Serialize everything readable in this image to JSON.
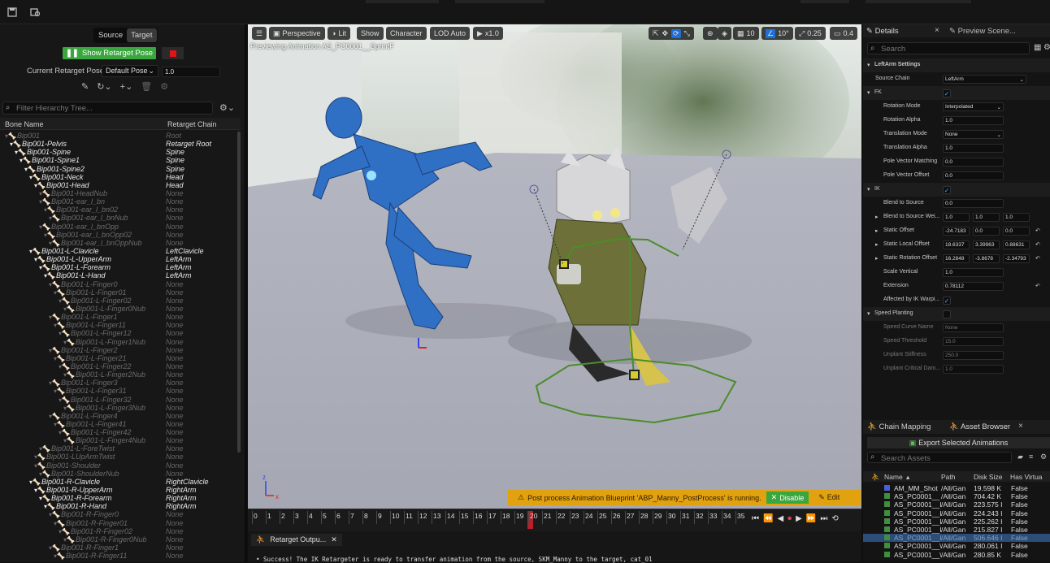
{
  "topbar": {
    "save_icon": "save-icon",
    "browse_icon": "browse-icon"
  },
  "left": {
    "tabs": [
      "Source",
      "Target"
    ],
    "show_retarget_pose": "Show Retarget Pose",
    "current_pose_label": "Current Retarget Pose:",
    "current_pose_value": "Default Pose",
    "pose_blend_value": "1.0",
    "filter_placeholder": "Filter Hierarchy Tree...",
    "col_bone": "Bone Name",
    "col_chain": "Retarget Chain",
    "bones": [
      {
        "name": "Bip001",
        "chain": "Root",
        "d": 0,
        "on": false
      },
      {
        "name": "Bip001-Pelvis",
        "chain": "Retarget Root",
        "d": 1,
        "on": true
      },
      {
        "name": "Bip001-Spine",
        "chain": "Spine",
        "d": 2,
        "on": true
      },
      {
        "name": "Bip001-Spine1",
        "chain": "Spine",
        "d": 3,
        "on": true
      },
      {
        "name": "Bip001-Spine2",
        "chain": "Spine",
        "d": 4,
        "on": true
      },
      {
        "name": "Bip001-Neck",
        "chain": "Head",
        "d": 5,
        "on": true
      },
      {
        "name": "Bip001-Head",
        "chain": "Head",
        "d": 6,
        "on": true
      },
      {
        "name": "Bip001-HeadNub",
        "chain": "None",
        "d": 7,
        "on": false
      },
      {
        "name": "Bip001-ear_l_bn",
        "chain": "None",
        "d": 7,
        "on": false
      },
      {
        "name": "Bip001-ear_l_bn02",
        "chain": "None",
        "d": 8,
        "on": false
      },
      {
        "name": "Bip001-ear_l_bnNub",
        "chain": "None",
        "d": 9,
        "on": false
      },
      {
        "name": "Bip001-ear_l_bnOpp",
        "chain": "None",
        "d": 7,
        "on": false
      },
      {
        "name": "Bip001-ear_l_bnOpp02",
        "chain": "None",
        "d": 8,
        "on": false
      },
      {
        "name": "Bip001-ear_l_bnOppNub",
        "chain": "None",
        "d": 9,
        "on": false
      },
      {
        "name": "Bip001-L-Clavicle",
        "chain": "LeftClavicle",
        "d": 5,
        "on": true
      },
      {
        "name": "Bip001-L-UpperArm",
        "chain": "LeftArm",
        "d": 6,
        "on": true
      },
      {
        "name": "Bip001-L-Forearm",
        "chain": "LeftArm",
        "d": 7,
        "on": true
      },
      {
        "name": "Bip001-L-Hand",
        "chain": "LeftArm",
        "d": 8,
        "on": true
      },
      {
        "name": "Bip001-L-Finger0",
        "chain": "None",
        "d": 9,
        "on": false
      },
      {
        "name": "Bip001-L-Finger01",
        "chain": "None",
        "d": 10,
        "on": false
      },
      {
        "name": "Bip001-L-Finger02",
        "chain": "None",
        "d": 11,
        "on": false
      },
      {
        "name": "Bip001-L-Finger0Nub",
        "chain": "None",
        "d": 12,
        "on": false
      },
      {
        "name": "Bip001-L-Finger1",
        "chain": "None",
        "d": 9,
        "on": false
      },
      {
        "name": "Bip001-L-Finger11",
        "chain": "None",
        "d": 10,
        "on": false
      },
      {
        "name": "Bip001-L-Finger12",
        "chain": "None",
        "d": 11,
        "on": false
      },
      {
        "name": "Bip001-L-Finger1Nub",
        "chain": "None",
        "d": 12,
        "on": false
      },
      {
        "name": "Bip001-L-Finger2",
        "chain": "None",
        "d": 9,
        "on": false
      },
      {
        "name": "Bip001-L-Finger21",
        "chain": "None",
        "d": 10,
        "on": false
      },
      {
        "name": "Bip001-L-Finger22",
        "chain": "None",
        "d": 11,
        "on": false
      },
      {
        "name": "Bip001-L-Finger2Nub",
        "chain": "None",
        "d": 12,
        "on": false
      },
      {
        "name": "Bip001-L-Finger3",
        "chain": "None",
        "d": 9,
        "on": false
      },
      {
        "name": "Bip001-L-Finger31",
        "chain": "None",
        "d": 10,
        "on": false
      },
      {
        "name": "Bip001-L-Finger32",
        "chain": "None",
        "d": 11,
        "on": false
      },
      {
        "name": "Bip001-L-Finger3Nub",
        "chain": "None",
        "d": 12,
        "on": false
      },
      {
        "name": "Bip001-L-Finger4",
        "chain": "None",
        "d": 9,
        "on": false
      },
      {
        "name": "Bip001-L-Finger41",
        "chain": "None",
        "d": 10,
        "on": false
      },
      {
        "name": "Bip001-L-Finger42",
        "chain": "None",
        "d": 11,
        "on": false
      },
      {
        "name": "Bip001-L-Finger4Nub",
        "chain": "None",
        "d": 12,
        "on": false
      },
      {
        "name": "Bip001-L-ForeTwist",
        "chain": "None",
        "d": 7,
        "on": false
      },
      {
        "name": "Bip001-LUpArmTwist",
        "chain": "None",
        "d": 6,
        "on": false
      },
      {
        "name": "Bip001-Shoulder",
        "chain": "None",
        "d": 6,
        "on": false
      },
      {
        "name": "Bip001-ShoulderNub",
        "chain": "None",
        "d": 7,
        "on": false
      },
      {
        "name": "Bip001-R-Clavicle",
        "chain": "RightClavicle",
        "d": 5,
        "on": true
      },
      {
        "name": "Bip001-R-UpperArm",
        "chain": "RightArm",
        "d": 6,
        "on": true
      },
      {
        "name": "Bip001-R-Forearm",
        "chain": "RightArm",
        "d": 7,
        "on": true
      },
      {
        "name": "Bip001-R-Hand",
        "chain": "RightArm",
        "d": 8,
        "on": true
      },
      {
        "name": "Bip001-R-Finger0",
        "chain": "None",
        "d": 9,
        "on": false
      },
      {
        "name": "Bip001-R-Finger01",
        "chain": "None",
        "d": 10,
        "on": false
      },
      {
        "name": "Bip001-R-Finger02",
        "chain": "None",
        "d": 11,
        "on": false
      },
      {
        "name": "Bip001-R-Finger0Nub",
        "chain": "None",
        "d": 12,
        "on": false
      },
      {
        "name": "Bip001-R-Finger1",
        "chain": "None",
        "d": 9,
        "on": false
      },
      {
        "name": "Bip001-R-Finger11",
        "chain": "None",
        "d": 10,
        "on": false
      }
    ]
  },
  "viewport": {
    "perspective": "Perspective",
    "lit": "Lit",
    "show": "Show",
    "character": "Character",
    "lod": "LOD Auto",
    "speed": "x1.0",
    "grid_size": "10",
    "angle": "10°",
    "scale": "0.25",
    "camera_speed": "0.4",
    "preview_text": "Previewing Animation AS_PC0001__SprintF",
    "warning": "Post process Animation Blueprint 'ABP_Manny_PostProcess' is running.",
    "disable": "Disable",
    "edit": "Edit"
  },
  "timeline": {
    "frames": [
      "0",
      "1",
      "2",
      "3",
      "4",
      "5",
      "6",
      "7",
      "8",
      "9",
      "10",
      "11",
      "12",
      "13",
      "14",
      "15",
      "16",
      "17",
      "18",
      "19",
      "20",
      "21",
      "22",
      "23",
      "24",
      "25",
      "26",
      "27",
      "28",
      "29",
      "30",
      "31",
      "32",
      "33",
      "34",
      "35"
    ],
    "current": 20
  },
  "log": {
    "tab": "Retarget Outpu...",
    "message": "Success! The IK Retargeter is ready to transfer animation from the source, SKM_Manny to the target, cat_01"
  },
  "details": {
    "tab": "Details",
    "tab2": "Preview Scene...",
    "search_placeholder": "Search",
    "section": "LeftArm Settings",
    "source_chain_label": "Source Chain",
    "source_chain_value": "LeftArm",
    "fk": "FK",
    "rotation_mode_label": "Rotation Mode",
    "rotation_mode_value": "Interpolated",
    "rotation_alpha_label": "Rotation Alpha",
    "rotation_alpha_value": "1.0",
    "translation_mode_label": "Translation Mode",
    "translation_mode_value": "None",
    "translation_alpha_label": "Translation Alpha",
    "translation_alpha_value": "1.0",
    "pole_match_label": "Pole Vector Matching",
    "pole_match_value": "0.0",
    "pole_offset_label": "Pole Vector Offset",
    "pole_offset_value": "0.0",
    "ik": "IK",
    "blend_source_label": "Blend to Source",
    "blend_source_value": "0.0",
    "blend_source_w_label": "Blend to Source Wei...",
    "blend_source_w": [
      "1.0",
      "1.0",
      "1.0"
    ],
    "static_offset_label": "Static Offset",
    "static_offset": [
      "-24.7183",
      "0.0",
      "0.0"
    ],
    "static_local_label": "Static Local Offset",
    "static_local": [
      "18.6337",
      "3.39963",
      "0.88631"
    ],
    "static_rot_label": "Static Rotation Offset",
    "static_rot": [
      "16.2848",
      "-3.8678",
      "-2.34793"
    ],
    "scale_vertical_label": "Scale Vertical",
    "scale_vertical_value": "1.0",
    "extension_label": "Extension",
    "extension_value": "0.78112",
    "ik_warp_label": "Affected by IK Warpi...",
    "speed_planting": "Speed Planting",
    "speed_curve_label": "Speed Curve Name",
    "speed_curve_value": "None",
    "speed_thresh_label": "Speed Threshold",
    "speed_thresh_value": "15.0",
    "unplant_stiff_label": "Unplant Stiffness",
    "unplant_stiff_value": "250.0",
    "unplant_damp_label": "Unplant Critical Dam...",
    "unplant_damp_value": "1.0"
  },
  "assets": {
    "tab1": "Chain Mapping",
    "tab2": "Asset Browser",
    "export_btn": "Export Selected Animations",
    "search_placeholder": "Search Assets",
    "cols": [
      "Name",
      "Path",
      "Disk Size",
      "Has Virtua"
    ],
    "rows": [
      {
        "name": "AM_MM_Shot",
        "path": "/All/Gan",
        "size": "19.598 K",
        "virt": "False",
        "kind": "montage"
      },
      {
        "name": "AS_PC0001__",
        "path": "/All/Gan",
        "size": "704.42 K",
        "virt": "False",
        "kind": "anim"
      },
      {
        "name": "AS_PC0001__I",
        "path": "/All/Gan",
        "size": "223.575 I",
        "virt": "False",
        "kind": "anim"
      },
      {
        "name": "AS_PC0001__I",
        "path": "/All/Gan",
        "size": "224.243 I",
        "virt": "False",
        "kind": "anim"
      },
      {
        "name": "AS_PC0001__I",
        "path": "/All/Gan",
        "size": "225.262 I",
        "virt": "False",
        "kind": "anim"
      },
      {
        "name": "AS_PC0001__I",
        "path": "/All/Gan",
        "size": "215.827 I",
        "virt": "False",
        "kind": "anim"
      },
      {
        "name": "AS_PC0001__I",
        "path": "/All/Gan",
        "size": "506.646 I",
        "virt": "False",
        "kind": "anim",
        "sel": true
      },
      {
        "name": "AS_PC0001__\\",
        "path": "/All/Gan",
        "size": "280.061 I",
        "virt": "False",
        "kind": "anim"
      },
      {
        "name": "AS_PC0001__\\",
        "path": "/All/Gan",
        "size": "280.85 K",
        "virt": "False",
        "kind": "anim"
      }
    ]
  }
}
